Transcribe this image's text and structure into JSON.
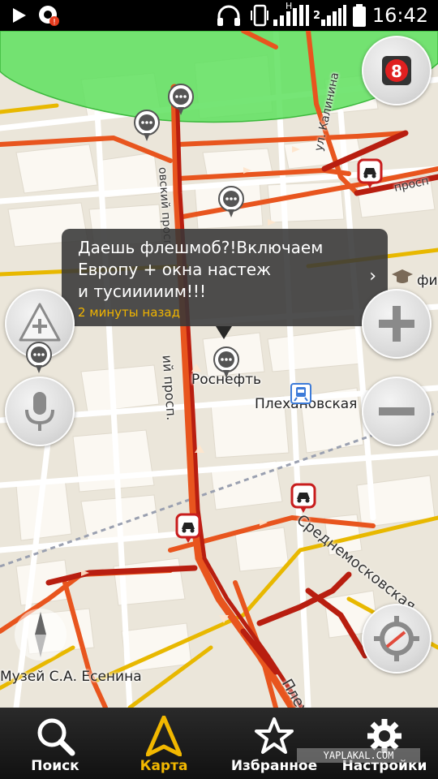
{
  "status_bar": {
    "time": "16:42",
    "icons": [
      "play-icon",
      "notification-icon",
      "headphones-icon",
      "vibrate-icon",
      "signal-h-icon",
      "signal-2-icon",
      "battery-icon"
    ],
    "network_badge": "H",
    "sim2_badge": "2"
  },
  "map": {
    "traffic_level": "8",
    "balloon": {
      "message": "Даешь флешмоб?!Включаем\nЕвропу + окна настеж\nи тусииииим!!!",
      "time_ago": "2 минуты назад"
    },
    "place_labels": {
      "rosneft": "Роснефть",
      "plekhanovskaya": "Плехановская",
      "museum": "Музей С.А. Есенина",
      "fi": "фи."
    },
    "street_labels": {
      "kalinina": "ул. Калинина",
      "prosp_top": "просп",
      "prosp_left": "овский просп.",
      "prosp_mid": "ий просп.",
      "sredne": "Среднемосковская",
      "plekh": "Плех"
    },
    "colors": {
      "jam_red": "#b81e10",
      "slow_orange": "#e8551e",
      "yellow": "#e8b800",
      "green_zone": "#5ee05e"
    }
  },
  "nav": {
    "items": [
      {
        "label": "Поиск",
        "icon": "search-icon"
      },
      {
        "label": "Карта",
        "icon": "map-arrow-icon"
      },
      {
        "label": "Избранное",
        "icon": "star-icon"
      },
      {
        "label": "Настройки",
        "icon": "gear-icon"
      }
    ],
    "active": "Карта"
  },
  "watermark": "YAPLAKAL.COM"
}
